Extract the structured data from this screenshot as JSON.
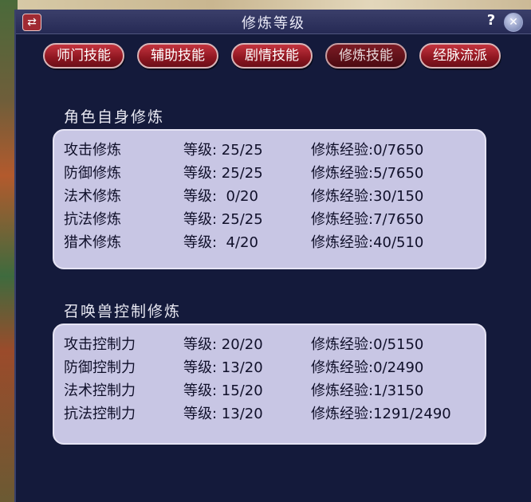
{
  "window": {
    "title": "修炼等级",
    "help_label": "?",
    "close_label": "✕",
    "left_icon_label": "⇄"
  },
  "tabs": [
    {
      "label": "师门技能",
      "active": false
    },
    {
      "label": "辅助技能",
      "active": false
    },
    {
      "label": "剧情技能",
      "active": false
    },
    {
      "label": "修炼技能",
      "active": true
    },
    {
      "label": "经脉流派",
      "active": false
    }
  ],
  "self_training": {
    "title": "角色自身修炼",
    "rows": [
      {
        "name": "攻击修炼",
        "level": "等级: 25/25",
        "exp": "修炼经验:0/7650"
      },
      {
        "name": "防御修炼",
        "level": "等级: 25/25",
        "exp": "修炼经验:5/7650"
      },
      {
        "name": "法术修炼",
        "level": "等级:  0/20",
        "exp": "修炼经验:30/150"
      },
      {
        "name": "抗法修炼",
        "level": "等级: 25/25",
        "exp": "修炼经验:7/7650"
      },
      {
        "name": "猎术修炼",
        "level": "等级:  4/20",
        "exp": "修炼经验:40/510"
      }
    ]
  },
  "pet_training": {
    "title": "召唤兽控制修炼",
    "rows": [
      {
        "name": "攻击控制力",
        "level": "等级: 20/20",
        "exp": "修炼经验:0/5150"
      },
      {
        "name": "防御控制力",
        "level": "等级: 13/20",
        "exp": "修炼经验:0/2490"
      },
      {
        "name": "法术控制力",
        "level": "等级: 15/20",
        "exp": "修炼经验:1/3150"
      },
      {
        "name": "抗法控制力",
        "level": "等级: 13/20",
        "exp": "修炼经验:1291/2490"
      }
    ]
  }
}
